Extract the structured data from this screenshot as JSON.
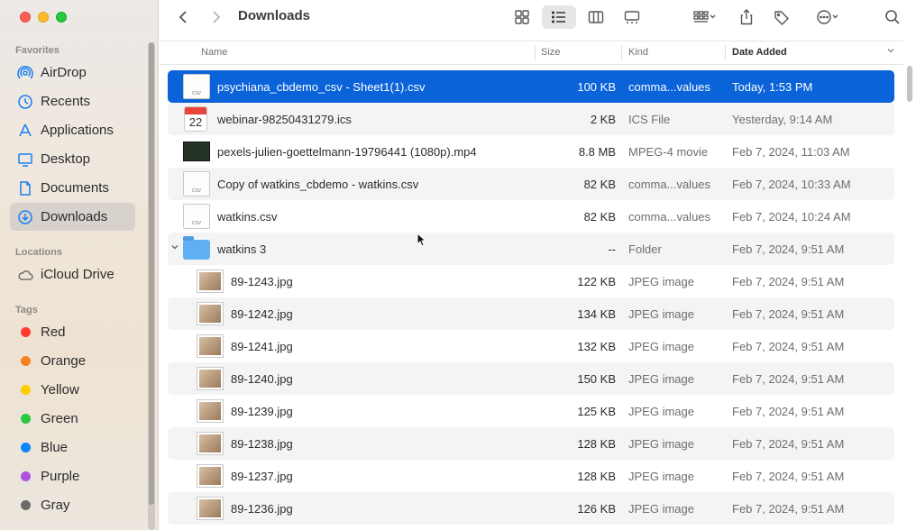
{
  "window": {
    "title": "Downloads"
  },
  "sidebar": {
    "favorites_label": "Favorites",
    "favorites": [
      {
        "label": "AirDrop",
        "icon": "airdrop-icon"
      },
      {
        "label": "Recents",
        "icon": "clock-icon"
      },
      {
        "label": "Applications",
        "icon": "applications-icon"
      },
      {
        "label": "Desktop",
        "icon": "desktop-icon"
      },
      {
        "label": "Documents",
        "icon": "document-icon"
      },
      {
        "label": "Downloads",
        "icon": "download-icon",
        "selected": true
      }
    ],
    "locations_label": "Locations",
    "locations": [
      {
        "label": "iCloud Drive",
        "icon": "cloud-icon"
      }
    ],
    "tags_label": "Tags",
    "tags": [
      {
        "label": "Red",
        "color": "#ff3b30"
      },
      {
        "label": "Orange",
        "color": "#f58220"
      },
      {
        "label": "Yellow",
        "color": "#ffcc00"
      },
      {
        "label": "Green",
        "color": "#28c840"
      },
      {
        "label": "Blue",
        "color": "#0a84ff"
      },
      {
        "label": "Purple",
        "color": "#af52de"
      },
      {
        "label": "Gray",
        "color": "#8e8e93"
      }
    ]
  },
  "columns": {
    "name": "Name",
    "size": "Size",
    "kind": "Kind",
    "date": "Date Added"
  },
  "files": [
    {
      "name": "psychiana_cbdemo_csv - Sheet1(1).csv",
      "size": "100 KB",
      "kind": "comma...values",
      "date": "Today, 1:53 PM",
      "icon": "csv-file-icon",
      "selected": true
    },
    {
      "name": "webinar-98250431279.ics",
      "size": "2 KB",
      "kind": "ICS File",
      "date": "Yesterday, 9:14 AM",
      "icon": "calendar-file-icon",
      "cal_month": "FEB",
      "cal_day": "22"
    },
    {
      "name": "pexels-julien-goettelmann-19796441 (1080p).mp4",
      "size": "8.8 MB",
      "kind": "MPEG-4 movie",
      "date": "Feb 7, 2024, 11:03 AM",
      "icon": "video-file-icon"
    },
    {
      "name": "Copy of watkins_cbdemo - watkins.csv",
      "size": "82 KB",
      "kind": "comma...values",
      "date": "Feb 7, 2024, 10:33 AM",
      "icon": "csv-file-icon"
    },
    {
      "name": "watkins.csv",
      "size": "82 KB",
      "kind": "comma...values",
      "date": "Feb 7, 2024, 10:24 AM",
      "icon": "csv-file-icon"
    },
    {
      "name": "watkins 3",
      "size": "--",
      "kind": "Folder",
      "date": "Feb 7, 2024, 9:51 AM",
      "icon": "folder-icon",
      "expanded": true
    },
    {
      "name": "89-1243.jpg",
      "size": "122 KB",
      "kind": "JPEG image",
      "date": "Feb 7, 2024, 9:51 AM",
      "icon": "image-file-icon",
      "child": true
    },
    {
      "name": "89-1242.jpg",
      "size": "134 KB",
      "kind": "JPEG image",
      "date": "Feb 7, 2024, 9:51 AM",
      "icon": "image-file-icon",
      "child": true
    },
    {
      "name": "89-1241.jpg",
      "size": "132 KB",
      "kind": "JPEG image",
      "date": "Feb 7, 2024, 9:51 AM",
      "icon": "image-file-icon",
      "child": true
    },
    {
      "name": "89-1240.jpg",
      "size": "150 KB",
      "kind": "JPEG image",
      "date": "Feb 7, 2024, 9:51 AM",
      "icon": "image-file-icon",
      "child": true
    },
    {
      "name": "89-1239.jpg",
      "size": "125 KB",
      "kind": "JPEG image",
      "date": "Feb 7, 2024, 9:51 AM",
      "icon": "image-file-icon",
      "child": true
    },
    {
      "name": "89-1238.jpg",
      "size": "128 KB",
      "kind": "JPEG image",
      "date": "Feb 7, 2024, 9:51 AM",
      "icon": "image-file-icon",
      "child": true
    },
    {
      "name": "89-1237.jpg",
      "size": "128 KB",
      "kind": "JPEG image",
      "date": "Feb 7, 2024, 9:51 AM",
      "icon": "image-file-icon",
      "child": true
    },
    {
      "name": "89-1236.jpg",
      "size": "126 KB",
      "kind": "JPEG image",
      "date": "Feb 7, 2024, 9:51 AM",
      "icon": "image-file-icon",
      "child": true
    }
  ],
  "colors": {
    "selection": "#0a63d9",
    "sidebar_selected": "#d7d2cc"
  }
}
